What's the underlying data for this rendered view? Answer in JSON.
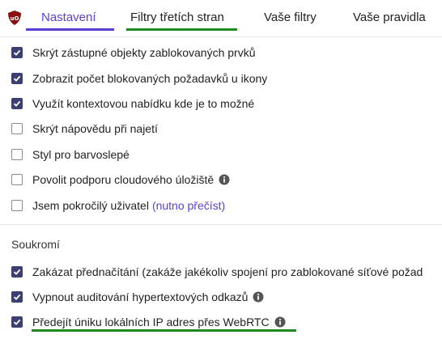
{
  "tabs": [
    {
      "label": "Nastavení",
      "active": true
    },
    {
      "label": "Filtry třetích stran",
      "active": false
    },
    {
      "label": "Vaše filtry",
      "active": false
    },
    {
      "label": "Vaše pravidla",
      "active": false
    }
  ],
  "colors": {
    "accent": "#5b3fd2",
    "checkbox_checked": "#3d3f73",
    "highlight_green": "#1f8a1f",
    "logo_red": "#8b0f0f"
  },
  "appearance": {
    "items": [
      {
        "label": "Skrýt zástupné objekty zablokovaných prvků",
        "checked": true
      },
      {
        "label": "Zobrazit počet blokovaných požadavků u ikony",
        "checked": true
      },
      {
        "label": "Využít kontextovou nabídku kde je to možné",
        "checked": true
      },
      {
        "label": "Skrýt nápovědu při najetí",
        "checked": false
      },
      {
        "label": "Styl pro barvoslepé",
        "checked": false
      },
      {
        "label": "Povolit podporu cloudového úložiště",
        "checked": false
      },
      {
        "label": "Jsem pokročilý uživatel",
        "link": "(nutno přečíst)",
        "checked": false
      }
    ]
  },
  "privacy": {
    "title": "Soukromí",
    "items": [
      {
        "label": "Zakázat přednačítání (zakáže jakékoliv spojení pro zablokované síťové požad",
        "checked": true
      },
      {
        "label": "Vypnout auditování hypertextových odkazů",
        "checked": true
      },
      {
        "label": "Předejít úniku lokálních IP adres přes WebRTC",
        "checked": true
      }
    ]
  }
}
